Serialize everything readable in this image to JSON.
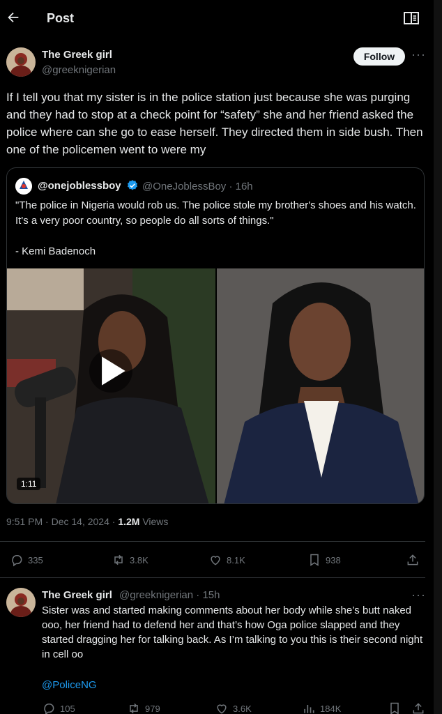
{
  "header": {
    "title": "Post"
  },
  "post": {
    "author_name": "The Greek girl",
    "author_handle": "@greeknigerian",
    "follow_label": "Follow",
    "text": "If I tell you that my sister is in the police station just because she was purging and they had to stop at a check point for “safety” she and her friend asked the police where can she go to ease herself. They directed them in side bush. Then one of the policemen went to were my",
    "time": "9:51 PM · Dec 14, 2024 · ",
    "views_count": "1.2M",
    "views_label": "Views",
    "stats": {
      "replies": "335",
      "reposts": "3.8K",
      "likes": "8.1K",
      "bookmarks": "938"
    }
  },
  "quote": {
    "author_name": "@onejoblessboy",
    "author_handle": "@OneJoblessBoy · 16h",
    "text": "\"The police in Nigeria would rob us. The police stole my brother's shoes and his watch. It's a very poor country, so people do all sorts of things.\"\n\n- Kemi Badenoch",
    "video_duration": "1:11"
  },
  "reply": {
    "author_name": "The Greek girl",
    "author_handle": "@greeknigerian · 15h",
    "text": "Sister was and started making comments about her body while she’s butt naked ooo, her friend had to defend her and that’s how Oga police slapped and they started dragging her for talking back. As I’m talking to you this is their second night in cell oo",
    "mention": "@PoliceNG",
    "stats": {
      "replies": "105",
      "reposts": "979",
      "likes": "3.6K",
      "views": "184K"
    }
  }
}
